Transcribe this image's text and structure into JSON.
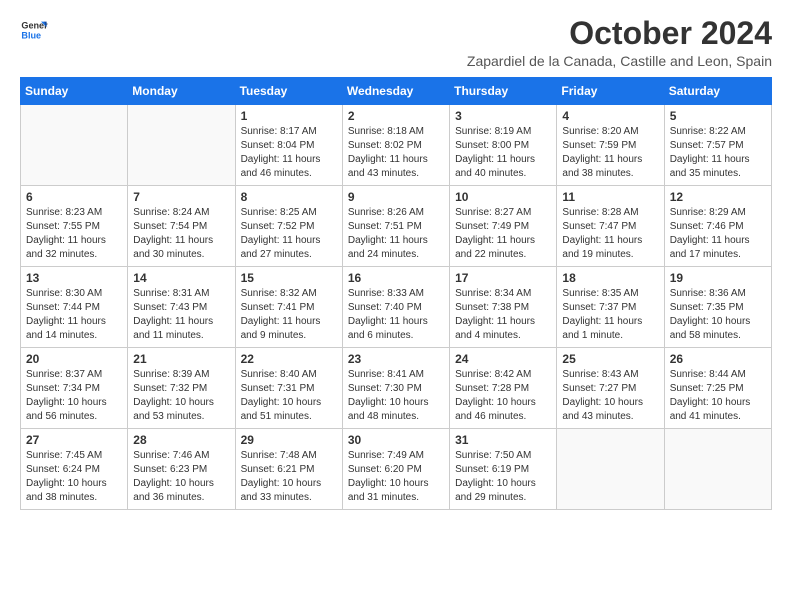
{
  "header": {
    "logo_line1": "General",
    "logo_line2": "Blue",
    "month_title": "October 2024",
    "subtitle": "Zapardiel de la Canada, Castille and Leon, Spain"
  },
  "weekdays": [
    "Sunday",
    "Monday",
    "Tuesday",
    "Wednesday",
    "Thursday",
    "Friday",
    "Saturday"
  ],
  "weeks": [
    [
      {
        "day": "",
        "info": ""
      },
      {
        "day": "",
        "info": ""
      },
      {
        "day": "1",
        "info": "Sunrise: 8:17 AM\nSunset: 8:04 PM\nDaylight: 11 hours and 46 minutes."
      },
      {
        "day": "2",
        "info": "Sunrise: 8:18 AM\nSunset: 8:02 PM\nDaylight: 11 hours and 43 minutes."
      },
      {
        "day": "3",
        "info": "Sunrise: 8:19 AM\nSunset: 8:00 PM\nDaylight: 11 hours and 40 minutes."
      },
      {
        "day": "4",
        "info": "Sunrise: 8:20 AM\nSunset: 7:59 PM\nDaylight: 11 hours and 38 minutes."
      },
      {
        "day": "5",
        "info": "Sunrise: 8:22 AM\nSunset: 7:57 PM\nDaylight: 11 hours and 35 minutes."
      }
    ],
    [
      {
        "day": "6",
        "info": "Sunrise: 8:23 AM\nSunset: 7:55 PM\nDaylight: 11 hours and 32 minutes."
      },
      {
        "day": "7",
        "info": "Sunrise: 8:24 AM\nSunset: 7:54 PM\nDaylight: 11 hours and 30 minutes."
      },
      {
        "day": "8",
        "info": "Sunrise: 8:25 AM\nSunset: 7:52 PM\nDaylight: 11 hours and 27 minutes."
      },
      {
        "day": "9",
        "info": "Sunrise: 8:26 AM\nSunset: 7:51 PM\nDaylight: 11 hours and 24 minutes."
      },
      {
        "day": "10",
        "info": "Sunrise: 8:27 AM\nSunset: 7:49 PM\nDaylight: 11 hours and 22 minutes."
      },
      {
        "day": "11",
        "info": "Sunrise: 8:28 AM\nSunset: 7:47 PM\nDaylight: 11 hours and 19 minutes."
      },
      {
        "day": "12",
        "info": "Sunrise: 8:29 AM\nSunset: 7:46 PM\nDaylight: 11 hours and 17 minutes."
      }
    ],
    [
      {
        "day": "13",
        "info": "Sunrise: 8:30 AM\nSunset: 7:44 PM\nDaylight: 11 hours and 14 minutes."
      },
      {
        "day": "14",
        "info": "Sunrise: 8:31 AM\nSunset: 7:43 PM\nDaylight: 11 hours and 11 minutes."
      },
      {
        "day": "15",
        "info": "Sunrise: 8:32 AM\nSunset: 7:41 PM\nDaylight: 11 hours and 9 minutes."
      },
      {
        "day": "16",
        "info": "Sunrise: 8:33 AM\nSunset: 7:40 PM\nDaylight: 11 hours and 6 minutes."
      },
      {
        "day": "17",
        "info": "Sunrise: 8:34 AM\nSunset: 7:38 PM\nDaylight: 11 hours and 4 minutes."
      },
      {
        "day": "18",
        "info": "Sunrise: 8:35 AM\nSunset: 7:37 PM\nDaylight: 11 hours and 1 minute."
      },
      {
        "day": "19",
        "info": "Sunrise: 8:36 AM\nSunset: 7:35 PM\nDaylight: 10 hours and 58 minutes."
      }
    ],
    [
      {
        "day": "20",
        "info": "Sunrise: 8:37 AM\nSunset: 7:34 PM\nDaylight: 10 hours and 56 minutes."
      },
      {
        "day": "21",
        "info": "Sunrise: 8:39 AM\nSunset: 7:32 PM\nDaylight: 10 hours and 53 minutes."
      },
      {
        "day": "22",
        "info": "Sunrise: 8:40 AM\nSunset: 7:31 PM\nDaylight: 10 hours and 51 minutes."
      },
      {
        "day": "23",
        "info": "Sunrise: 8:41 AM\nSunset: 7:30 PM\nDaylight: 10 hours and 48 minutes."
      },
      {
        "day": "24",
        "info": "Sunrise: 8:42 AM\nSunset: 7:28 PM\nDaylight: 10 hours and 46 minutes."
      },
      {
        "day": "25",
        "info": "Sunrise: 8:43 AM\nSunset: 7:27 PM\nDaylight: 10 hours and 43 minutes."
      },
      {
        "day": "26",
        "info": "Sunrise: 8:44 AM\nSunset: 7:25 PM\nDaylight: 10 hours and 41 minutes."
      }
    ],
    [
      {
        "day": "27",
        "info": "Sunrise: 7:45 AM\nSunset: 6:24 PM\nDaylight: 10 hours and 38 minutes."
      },
      {
        "day": "28",
        "info": "Sunrise: 7:46 AM\nSunset: 6:23 PM\nDaylight: 10 hours and 36 minutes."
      },
      {
        "day": "29",
        "info": "Sunrise: 7:48 AM\nSunset: 6:21 PM\nDaylight: 10 hours and 33 minutes."
      },
      {
        "day": "30",
        "info": "Sunrise: 7:49 AM\nSunset: 6:20 PM\nDaylight: 10 hours and 31 minutes."
      },
      {
        "day": "31",
        "info": "Sunrise: 7:50 AM\nSunset: 6:19 PM\nDaylight: 10 hours and 29 minutes."
      },
      {
        "day": "",
        "info": ""
      },
      {
        "day": "",
        "info": ""
      }
    ]
  ]
}
